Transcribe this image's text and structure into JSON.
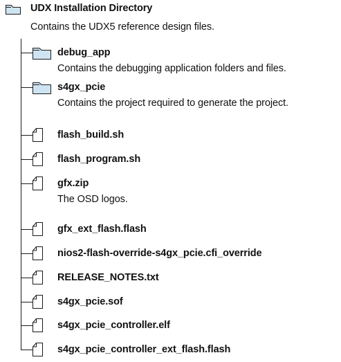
{
  "root": {
    "name": "UDX Installation Directory",
    "description": "Contains the UDX5 reference design files.",
    "icon": "folder-icon"
  },
  "entries": [
    {
      "type": "folder",
      "icon": "folder-icon",
      "name": "debug_app",
      "description": "Contains the debugging application folders and files."
    },
    {
      "type": "folder",
      "icon": "folder-icon",
      "name": "s4gx_pcie",
      "description": "Contains the project required to generate the project."
    },
    {
      "type": "file",
      "icon": "file-icon",
      "name": "flash_build.sh"
    },
    {
      "type": "file",
      "icon": "file-icon",
      "name": "flash_program.sh"
    },
    {
      "type": "file",
      "icon": "file-icon",
      "name": "gfx.zip",
      "description": "The OSD logos."
    },
    {
      "type": "file",
      "icon": "file-icon",
      "name": "gfx_ext_flash.flash"
    },
    {
      "type": "file",
      "icon": "file-icon",
      "name": "nios2-flash-override-s4gx_pcie.cfi_override"
    },
    {
      "type": "file",
      "icon": "file-icon",
      "name": "RELEASE_NOTES.txt"
    },
    {
      "type": "file",
      "icon": "file-icon",
      "name": "s4gx_pcie.sof"
    },
    {
      "type": "file",
      "icon": "file-icon",
      "name": "s4gx_pcie_controller.elf"
    },
    {
      "type": "file",
      "icon": "file-icon",
      "name": "s4gx_pcie_controller_ext_flash.flash"
    }
  ],
  "colors": {
    "folder_fill": "#cfe4f2",
    "line": "#1a1a1a",
    "text": "#111111"
  }
}
